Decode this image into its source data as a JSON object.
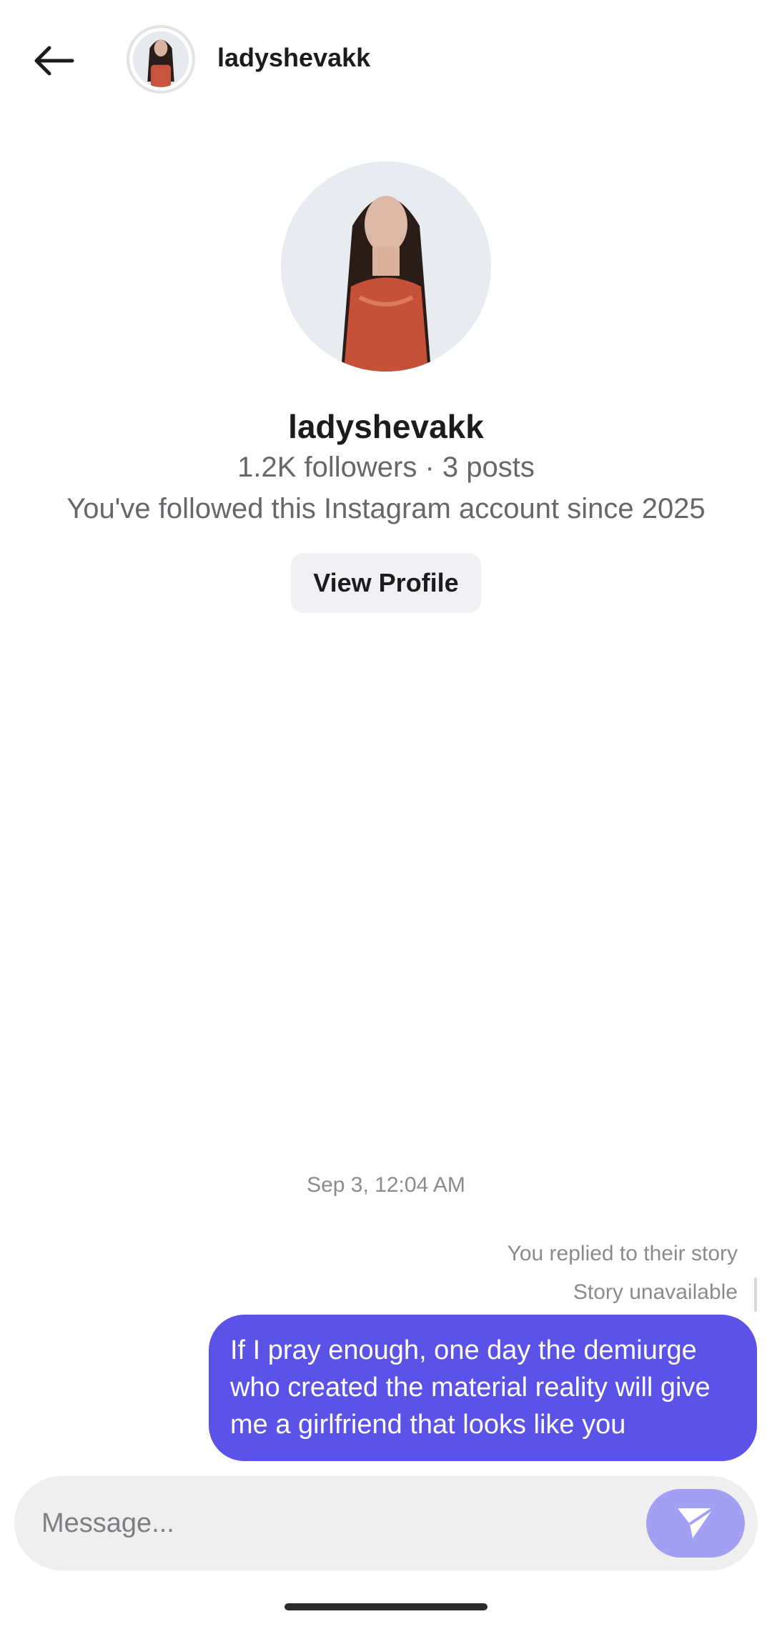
{
  "header": {
    "username": "ladyshevakk",
    "back_icon": "arrow-left-icon"
  },
  "profile": {
    "name": "ladyshevakk",
    "stats": "1.2K followers · 3 posts",
    "since": "You've followed this Instagram account since 2025",
    "view_profile_label": "View Profile"
  },
  "conversation": {
    "timestamp": "Sep 3, 12:04 AM",
    "reply_note": "You replied to their story",
    "story_note": "Story unavailable",
    "messages": [
      {
        "from": "me",
        "text": "If I pray enough, one day the demiurge who created the material reality will give me a girlfriend that looks like you"
      }
    ]
  },
  "composer": {
    "placeholder": "Message...",
    "value": "",
    "send_icon": "send-icon"
  },
  "colors": {
    "bubble": "#5b52e8",
    "send_button": "#a3a0f4",
    "composer_bg": "#efefef",
    "muted_text": "#66676b"
  }
}
